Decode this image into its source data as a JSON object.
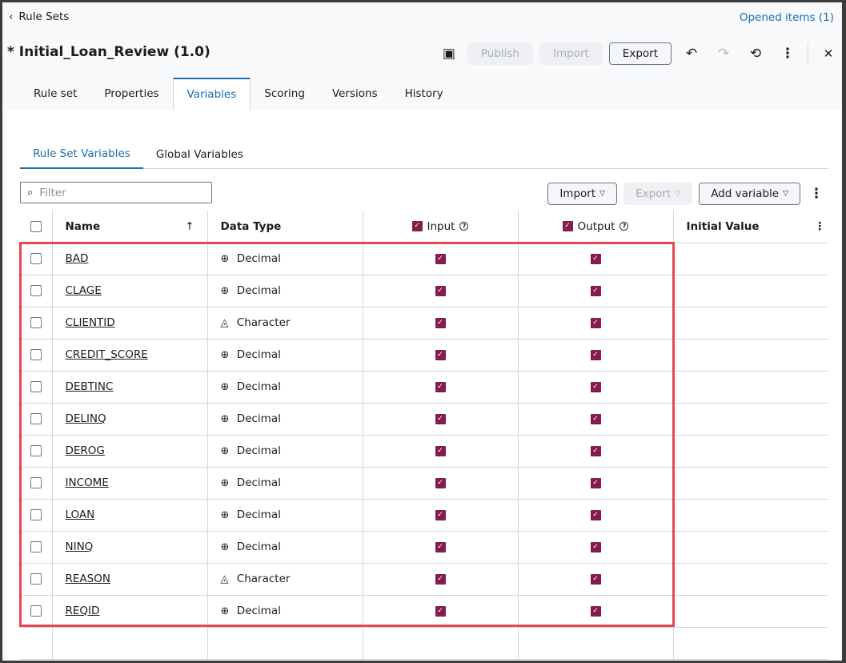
{
  "header": {
    "back_label": "Rule Sets",
    "opened_items": "Opened items (1)",
    "title": "* Initial_Loan_Review (1.0)"
  },
  "toolbar": {
    "publish": "Publish",
    "import": "Import",
    "export": "Export"
  },
  "tabs": [
    "Rule set",
    "Properties",
    "Variables",
    "Scoring",
    "Versions",
    "History"
  ],
  "subtabs": [
    "Rule Set Variables",
    "Global Variables"
  ],
  "filter": {
    "placeholder": "Filter"
  },
  "actions": {
    "import": "Import",
    "export": "Export",
    "add_variable": "Add variable"
  },
  "table": {
    "columns": {
      "name": "Name",
      "data_type": "Data Type",
      "input": "Input",
      "output": "Output",
      "initial_value": "Initial Value"
    },
    "rows": [
      {
        "name": "BAD",
        "type": "Decimal",
        "input": true,
        "output": true
      },
      {
        "name": "CLAGE",
        "type": "Decimal",
        "input": true,
        "output": true
      },
      {
        "name": "CLIENTID",
        "type": "Character",
        "input": true,
        "output": true
      },
      {
        "name": "CREDIT_SCORE",
        "type": "Decimal",
        "input": true,
        "output": true
      },
      {
        "name": "DEBTINC",
        "type": "Decimal",
        "input": true,
        "output": true
      },
      {
        "name": "DELINQ",
        "type": "Decimal",
        "input": true,
        "output": true
      },
      {
        "name": "DEROG",
        "type": "Decimal",
        "input": true,
        "output": true
      },
      {
        "name": "INCOME",
        "type": "Decimal",
        "input": true,
        "output": true
      },
      {
        "name": "LOAN",
        "type": "Decimal",
        "input": true,
        "output": true
      },
      {
        "name": "NINQ",
        "type": "Decimal",
        "input": true,
        "output": true
      },
      {
        "name": "REASON",
        "type": "Character",
        "input": true,
        "output": true
      },
      {
        "name": "REQID",
        "type": "Decimal",
        "input": true,
        "output": true
      }
    ]
  },
  "colors": {
    "accent": "#1a6fb5",
    "checkbox": "#841c4c",
    "highlight": "#e5484d"
  }
}
